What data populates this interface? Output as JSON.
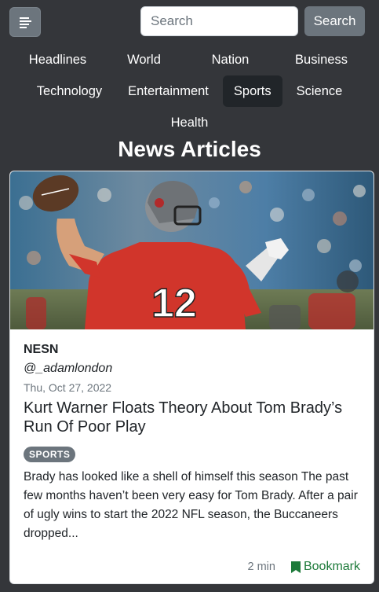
{
  "header": {
    "search_placeholder": "Search",
    "search_button": "Search"
  },
  "nav": {
    "items": [
      {
        "label": "Headlines"
      },
      {
        "label": "World"
      },
      {
        "label": "Nation"
      },
      {
        "label": "Business"
      },
      {
        "label": "Technology"
      },
      {
        "label": "Entertainment"
      },
      {
        "label": "Sports",
        "active": true
      },
      {
        "label": "Science"
      },
      {
        "label": "Health"
      }
    ]
  },
  "page_title": "News Articles",
  "article": {
    "source": "NESN",
    "author": "@_adamlondon",
    "date": "Thu, Oct 27, 2022",
    "title": "Kurt Warner Floats Theory About Tom Brady’s Run Of Poor Play",
    "tag": "SPORTS",
    "description": "Brady has looked like a shell of himself this season The past few months haven’t been very easy for Tom Brady. After a pair of ugly wins to start the 2022 NFL season, the Buccaneers dropped...",
    "read_time": "2 min",
    "bookmark_label": "Bookmark",
    "image_alt": "Quarterback in red number 12 jersey throwing a football"
  },
  "colors": {
    "background": "#34363a",
    "button": "#6c757d",
    "active_nav": "#212529",
    "bookmark": "#1d7a3a"
  }
}
